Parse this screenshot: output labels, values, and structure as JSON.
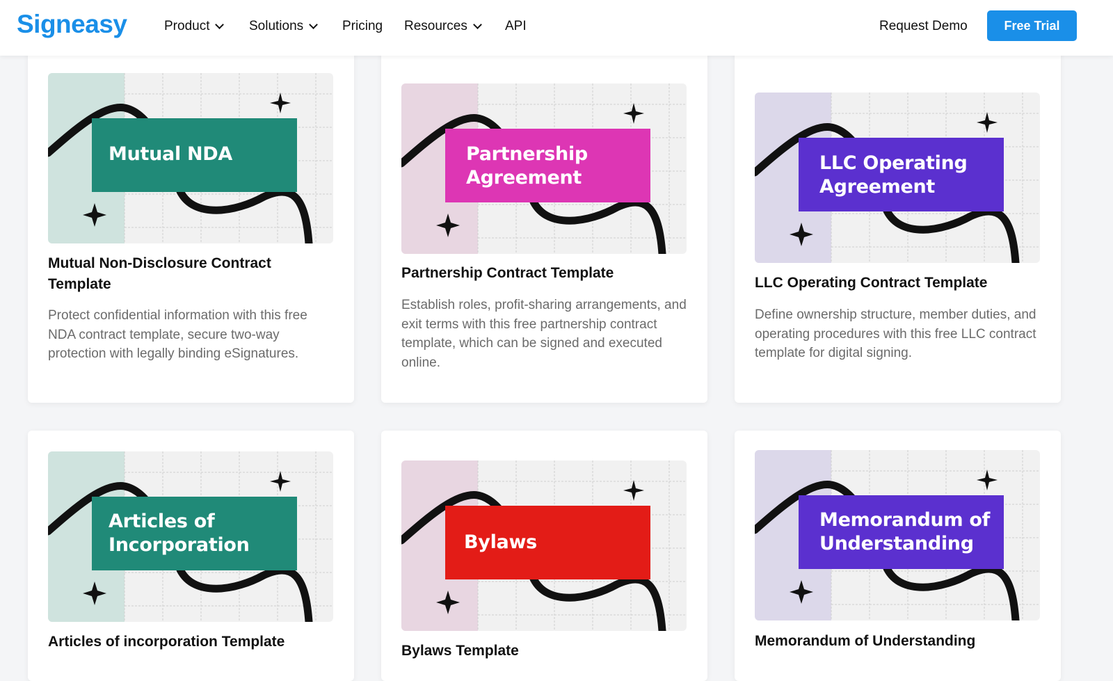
{
  "brand": {
    "logo_text": "Signeasy",
    "logo_color": "#1a8fe8",
    "accent": "#1a8fe8"
  },
  "nav": {
    "items": [
      {
        "label": "Product",
        "has_dropdown": true
      },
      {
        "label": "Solutions",
        "has_dropdown": true
      },
      {
        "label": "Pricing",
        "has_dropdown": false
      },
      {
        "label": "Resources",
        "has_dropdown": true
      },
      {
        "label": "API",
        "has_dropdown": false
      }
    ],
    "request_demo": "Request Demo",
    "free_trial": "Free Trial"
  },
  "cards": [
    {
      "banner_line1": "Mutual NDA",
      "banner_line2": "",
      "banner_color": "#208a78",
      "side_color": "#cfe3de",
      "title": "Mutual Non-Disclosure Contract Template",
      "description": "Protect confidential information with this free NDA contract template, secure two-way protection with legally binding eSignatures."
    },
    {
      "banner_line1": "Partnership",
      "banner_line2": "Agreement",
      "banner_color": "#dd36b4",
      "side_color": "#e8d6e1",
      "title": "Partnership Contract Template",
      "description": "Establish roles, profit-sharing arrangements, and exit terms with this free partnership contract template, which can be signed and executed online."
    },
    {
      "banner_line1": "LLC Operating",
      "banner_line2": "Agreement",
      "banner_color": "#5b30cf",
      "side_color": "#dcd8ea",
      "title": "LLC Operating Contract Template",
      "description": "Define ownership structure, member duties, and operating procedures with this free LLC contract template for digital signing."
    },
    {
      "banner_line1": "Articles of",
      "banner_line2": "Incorporation",
      "banner_color": "#208a78",
      "side_color": "#cfe3de",
      "title": "Articles of incorporation Template",
      "description": ""
    },
    {
      "banner_line1": "Bylaws",
      "banner_line2": "",
      "banner_color": "#e31c17",
      "side_color": "#e8d6e1",
      "title": "Bylaws Template",
      "description": ""
    },
    {
      "banner_line1": "Memorandum of",
      "banner_line2": "Understanding",
      "banner_color": "#5b30cf",
      "side_color": "#dcd8ea",
      "title": "Memorandum of Understanding",
      "description": ""
    }
  ]
}
